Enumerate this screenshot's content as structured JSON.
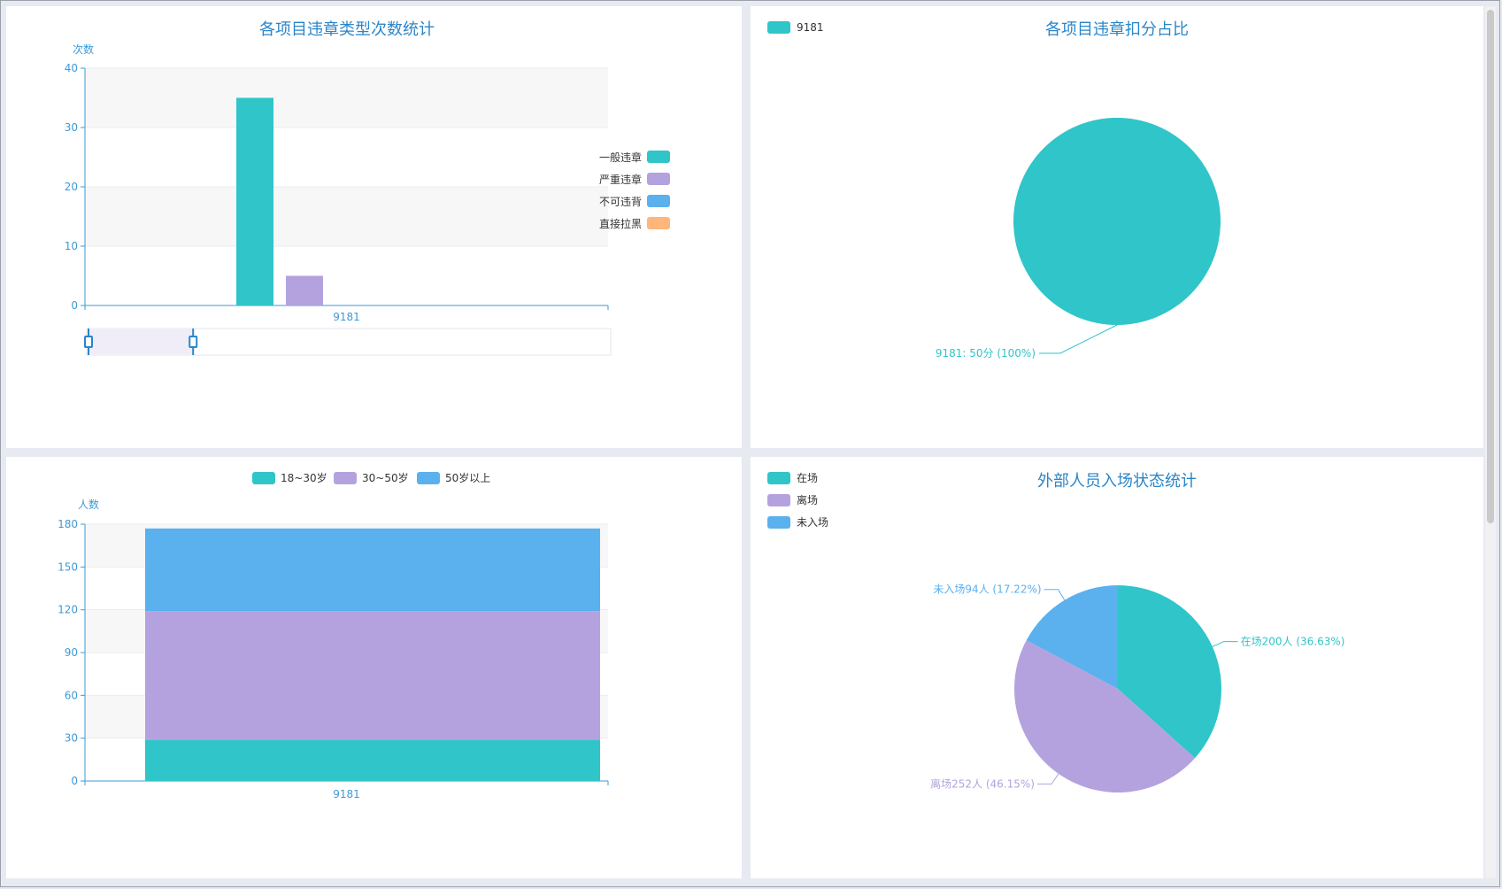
{
  "charts": [
    {
      "title": "各项目违章类型次数统计",
      "ylabel": "次数"
    },
    {
      "title": "各项目违章扣分占比"
    },
    {
      "ylabel": "人数"
    },
    {
      "title": "外部人员入场状态统计"
    }
  ],
  "colors": {
    "teal": "#2fc5c9",
    "purple": "#b4a2df",
    "blue": "#5bb0ee",
    "orange": "#ffb67b",
    "title": "#2a86c8",
    "axis": "#3d9ad6"
  },
  "chart_data": [
    {
      "type": "bar",
      "title": "各项目违章类型次数统计",
      "ylabel": "次数",
      "categories": [
        "9181"
      ],
      "ylim": [
        0,
        40
      ],
      "yticks": [
        0,
        10,
        20,
        30,
        40
      ],
      "series": [
        {
          "name": "一般违章",
          "values": [
            35
          ],
          "color": "#2fc5c9"
        },
        {
          "name": "严重违章",
          "values": [
            5
          ],
          "color": "#b4a2df"
        },
        {
          "name": "不可违背",
          "values": [
            0
          ],
          "color": "#5bb0ee"
        },
        {
          "name": "直接拉黑",
          "values": [
            0
          ],
          "color": "#ffb67b"
        }
      ],
      "legend": "right",
      "datazoom": {
        "start": 0,
        "end": 0.2
      }
    },
    {
      "type": "pie",
      "title": "各项目违章扣分占比",
      "slices": [
        {
          "name": "9181",
          "value": 50,
          "label": "9181: 50分 (100%)",
          "color": "#2fc5c9"
        }
      ],
      "legend": "top-left"
    },
    {
      "type": "bar",
      "stacked": true,
      "ylabel": "人数",
      "categories": [
        "9181"
      ],
      "ylim": [
        0,
        180
      ],
      "yticks": [
        0,
        30,
        60,
        90,
        120,
        150,
        180
      ],
      "series": [
        {
          "name": "18~30岁",
          "values": [
            29
          ],
          "color": "#2fc5c9"
        },
        {
          "name": "30~50岁",
          "values": [
            90
          ],
          "color": "#b4a2df"
        },
        {
          "name": "50岁以上",
          "values": [
            58
          ],
          "color": "#5bb0ee"
        }
      ],
      "legend": "top"
    },
    {
      "type": "pie",
      "title": "外部人员入场状态统计",
      "slices": [
        {
          "name": "在场",
          "value": 200,
          "label": "在场200人 (36.63%)",
          "color": "#2fc5c9"
        },
        {
          "name": "离场",
          "value": 252,
          "label": "离场252人 (46.15%)",
          "color": "#b4a2df"
        },
        {
          "name": "未入场",
          "value": 94,
          "label": "未入场94人 (17.22%)",
          "color": "#5bb0ee"
        }
      ],
      "legend": "top-left"
    }
  ]
}
